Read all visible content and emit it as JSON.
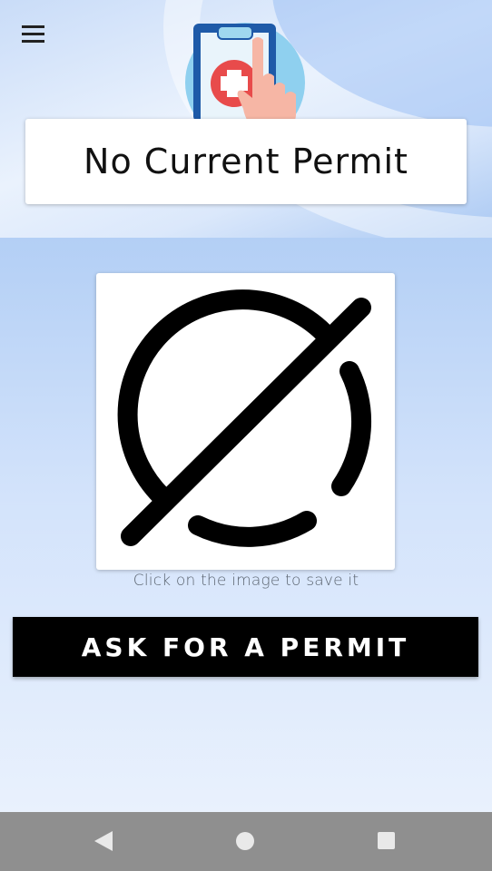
{
  "header": {
    "title": "No Current Permit",
    "menu_icon": "hamburger-menu-icon",
    "logo_icon": "medical-clipboard-hand-icon"
  },
  "permit_image": {
    "icon": "no-symbol-icon"
  },
  "caption": "Click on the image to save it",
  "ask_button": "ASK FOR A PERMIT",
  "navbar": {
    "back_icon": "back-triangle-icon",
    "home_icon": "home-circle-icon",
    "recent_icon": "recent-apps-square-icon"
  },
  "colors": {
    "button_bg": "#000000",
    "navbar_bg": "#8f8f8f",
    "background_top": "#b3cff5",
    "background_bottom": "#e9f1fd"
  }
}
